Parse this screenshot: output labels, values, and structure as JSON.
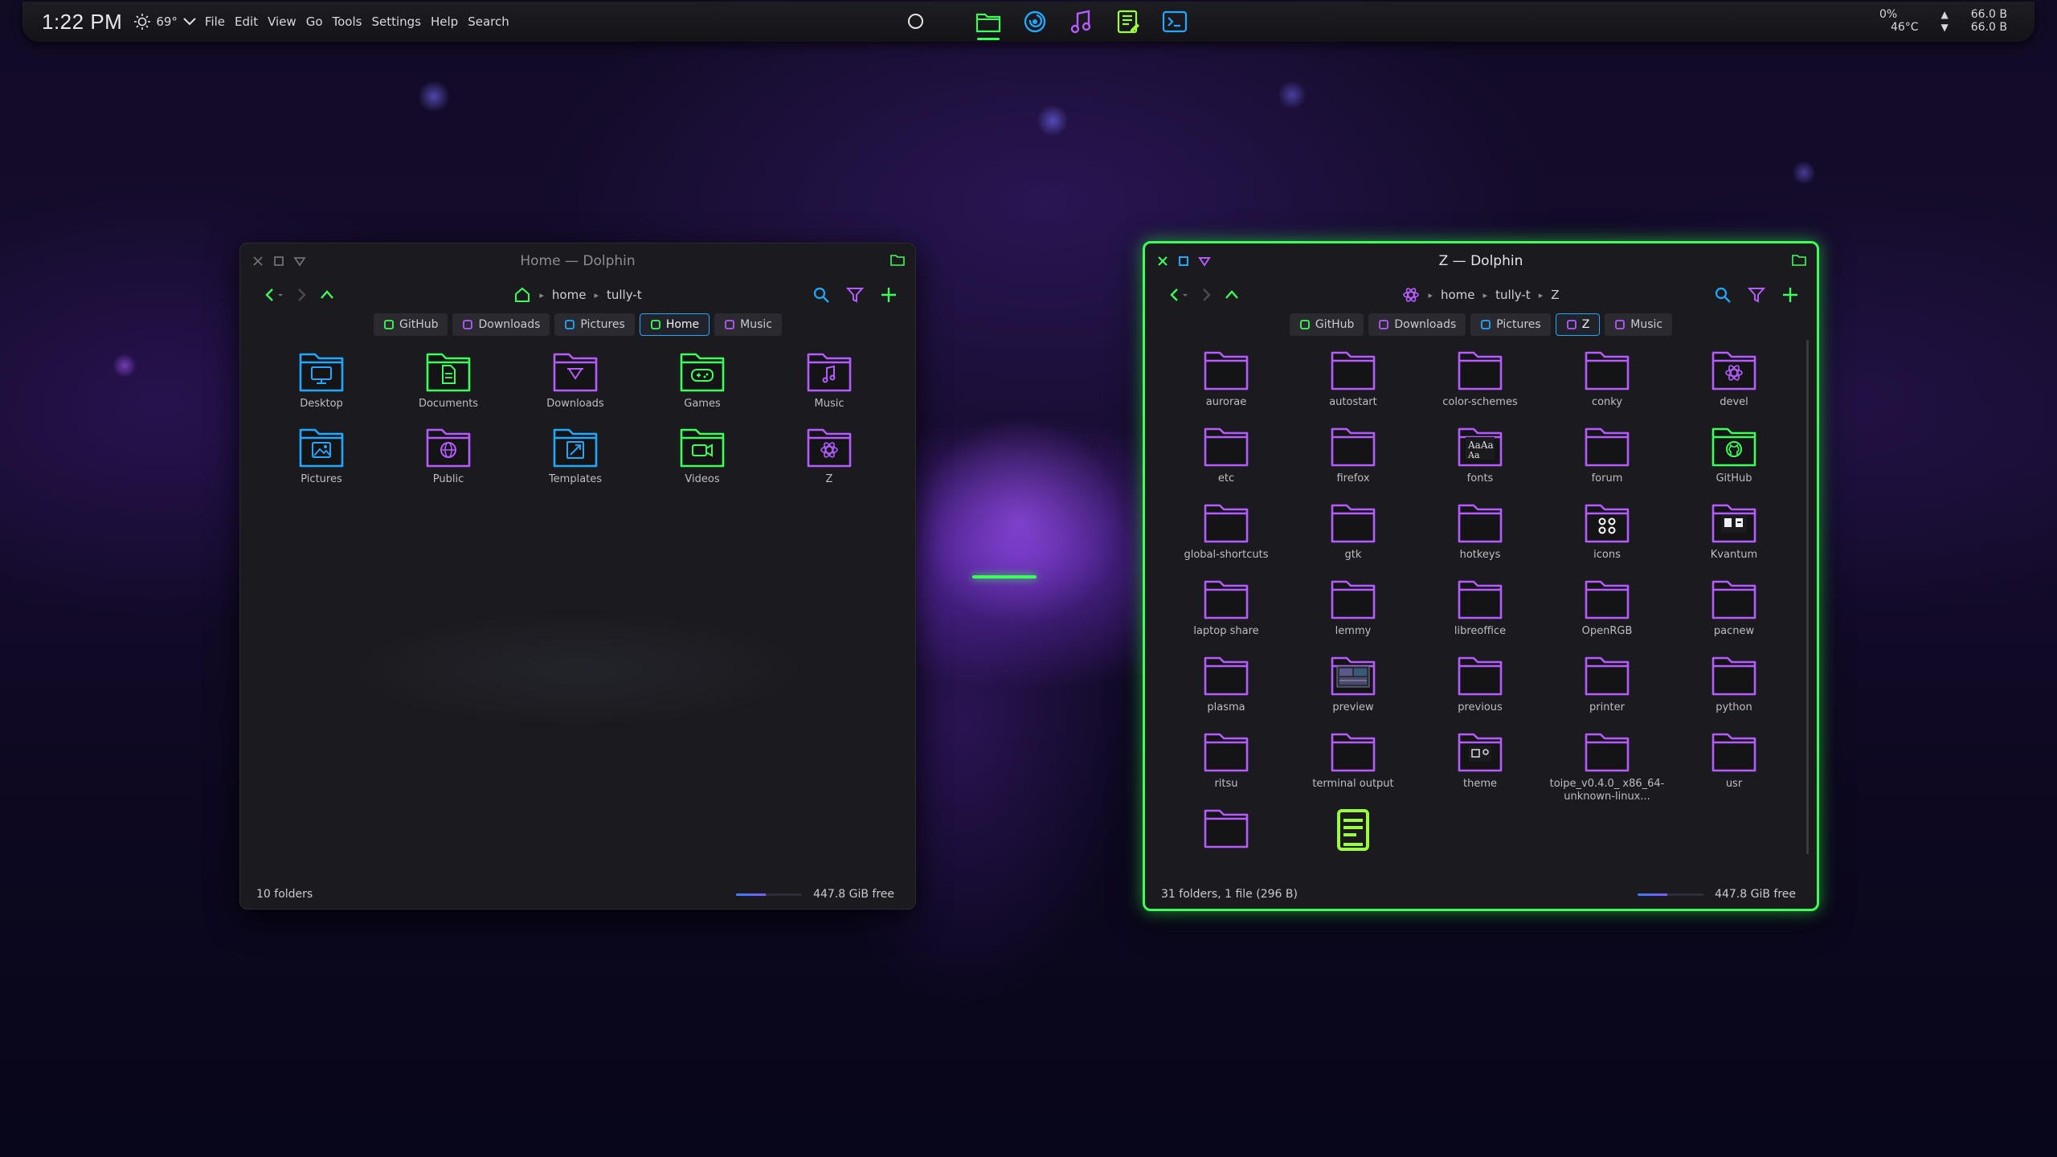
{
  "panel": {
    "clock": "1:22 PM",
    "temperature": "69°",
    "menu": [
      "File",
      "Edit",
      "View",
      "Go",
      "Tools",
      "Settings",
      "Help",
      "Search"
    ],
    "sys_cpu": "0%",
    "sys_temp": "46°C",
    "net_up": "66.0 B",
    "net_down": "66.0 B",
    "taskbar": [
      {
        "name": "dolphin-task",
        "icon": "folder-icon",
        "color": "#3cff5a",
        "active": true
      },
      {
        "name": "browser-task",
        "icon": "browser-swirl-icon",
        "color": "#22a8ff",
        "active": false
      },
      {
        "name": "music-task",
        "icon": "music-note-icon",
        "color": "#b45cff",
        "active": false
      },
      {
        "name": "editor-task",
        "icon": "text-editor-icon",
        "color": "#9bff3c",
        "active": false
      },
      {
        "name": "terminal-task",
        "icon": "terminal-icon",
        "color": "#22a8ff",
        "active": false
      }
    ]
  },
  "home_window": {
    "title": "Home — Dolphin",
    "breadcrumb": [
      "home",
      "tully-t"
    ],
    "places": [
      {
        "label": "GitHub",
        "color": "#3cff5a",
        "active": false
      },
      {
        "label": "Downloads",
        "color": "#b45cff",
        "active": false
      },
      {
        "label": "Pictures",
        "color": "#22a8ff",
        "active": false
      },
      {
        "label": "Home",
        "color": "#3cff5a",
        "active": true
      },
      {
        "label": "Music",
        "color": "#b45cff",
        "active": false
      }
    ],
    "items": [
      {
        "label": "Desktop",
        "icon": "desktop-folder-icon",
        "color": "#22a8ff",
        "emblem": "monitor"
      },
      {
        "label": "Documents",
        "icon": "documents-folder-icon",
        "color": "#3cff5a",
        "emblem": "doc"
      },
      {
        "label": "Downloads",
        "icon": "downloads-folder-icon",
        "color": "#b45cff",
        "emblem": "download"
      },
      {
        "label": "Games",
        "icon": "games-folder-icon",
        "color": "#3cff5a",
        "emblem": "gamepad"
      },
      {
        "label": "Music",
        "icon": "music-folder-icon",
        "color": "#b45cff",
        "emblem": "note"
      },
      {
        "label": "Pictures",
        "icon": "pictures-folder-icon",
        "color": "#22a8ff",
        "emblem": "image"
      },
      {
        "label": "Public",
        "icon": "public-folder-icon",
        "color": "#b45cff",
        "emblem": "globe"
      },
      {
        "label": "Templates",
        "icon": "templates-folder-icon",
        "color": "#22a8ff",
        "emblem": "template"
      },
      {
        "label": "Videos",
        "icon": "videos-folder-icon",
        "color": "#3cff5a",
        "emblem": "video"
      },
      {
        "label": "Z",
        "icon": "z-folder-icon",
        "color": "#b45cff",
        "emblem": "atom"
      }
    ],
    "status": "10 folders",
    "free_space": "447.8 GiB free",
    "free_fraction": 0.45
  },
  "z_window": {
    "title": "Z — Dolphin",
    "breadcrumb": [
      "home",
      "tully-t",
      "Z"
    ],
    "places": [
      {
        "label": "GitHub",
        "color": "#3cff5a",
        "active": false
      },
      {
        "label": "Downloads",
        "color": "#b45cff",
        "active": false
      },
      {
        "label": "Pictures",
        "color": "#22a8ff",
        "active": false
      },
      {
        "label": "Z",
        "color": "#b45cff",
        "active": true
      },
      {
        "label": "Music",
        "color": "#b45cff",
        "active": false
      }
    ],
    "items": [
      {
        "label": "aurorae",
        "icon": "folder-icon",
        "color": "#b45cff",
        "emblem": ""
      },
      {
        "label": "autostart",
        "icon": "folder-icon",
        "color": "#b45cff",
        "emblem": ""
      },
      {
        "label": "color-schemes",
        "icon": "folder-icon",
        "color": "#b45cff",
        "emblem": ""
      },
      {
        "label": "conky",
        "icon": "folder-icon",
        "color": "#b45cff",
        "emblem": ""
      },
      {
        "label": "devel",
        "icon": "devel-folder-icon",
        "color": "#b45cff",
        "emblem": "atom"
      },
      {
        "label": "etc",
        "icon": "folder-icon",
        "color": "#b45cff",
        "emblem": ""
      },
      {
        "label": "firefox",
        "icon": "folder-icon",
        "color": "#b45cff",
        "emblem": ""
      },
      {
        "label": "fonts",
        "icon": "fonts-folder-icon",
        "color": "#b45cff",
        "emblem": "fonts"
      },
      {
        "label": "forum",
        "icon": "folder-icon",
        "color": "#b45cff",
        "emblem": ""
      },
      {
        "label": "GitHub",
        "icon": "github-folder-icon",
        "color": "#3cff5a",
        "emblem": "github"
      },
      {
        "label": "global-shortcuts",
        "icon": "folder-icon",
        "color": "#b45cff",
        "emblem": ""
      },
      {
        "label": "gtk",
        "icon": "folder-icon",
        "color": "#b45cff",
        "emblem": ""
      },
      {
        "label": "hotkeys",
        "icon": "folder-icon",
        "color": "#b45cff",
        "emblem": ""
      },
      {
        "label": "icons",
        "icon": "icons-folder-icon",
        "color": "#b45cff",
        "emblem": "icons"
      },
      {
        "label": "Kvantum",
        "icon": "kvantum-folder-icon",
        "color": "#b45cff",
        "emblem": "kvantum"
      },
      {
        "label": "laptop share",
        "icon": "folder-icon",
        "color": "#b45cff",
        "emblem": ""
      },
      {
        "label": "lemmy",
        "icon": "folder-icon",
        "color": "#b45cff",
        "emblem": ""
      },
      {
        "label": "libreoffice",
        "icon": "folder-icon",
        "color": "#b45cff",
        "emblem": ""
      },
      {
        "label": "OpenRGB",
        "icon": "folder-icon",
        "color": "#b45cff",
        "emblem": ""
      },
      {
        "label": "pacnew",
        "icon": "folder-icon",
        "color": "#b45cff",
        "emblem": ""
      },
      {
        "label": "plasma",
        "icon": "folder-icon",
        "color": "#b45cff",
        "emblem": ""
      },
      {
        "label": "preview",
        "icon": "preview-folder-icon",
        "color": "#b45cff",
        "emblem": "preview"
      },
      {
        "label": "previous",
        "icon": "folder-icon",
        "color": "#b45cff",
        "emblem": ""
      },
      {
        "label": "printer",
        "icon": "folder-icon",
        "color": "#b45cff",
        "emblem": ""
      },
      {
        "label": "python",
        "icon": "folder-icon",
        "color": "#b45cff",
        "emblem": ""
      },
      {
        "label": "ritsu",
        "icon": "folder-icon",
        "color": "#b45cff",
        "emblem": ""
      },
      {
        "label": "terminal output",
        "icon": "folder-icon",
        "color": "#b45cff",
        "emblem": ""
      },
      {
        "label": "theme",
        "icon": "theme-folder-icon",
        "color": "#b45cff",
        "emblem": "theme"
      },
      {
        "label": "toipe_v0.4.0_ x86_64- unknown-linux...",
        "icon": "folder-icon",
        "color": "#b45cff",
        "emblem": ""
      },
      {
        "label": "usr",
        "icon": "folder-icon",
        "color": "#b45cff",
        "emblem": ""
      },
      {
        "label": "",
        "icon": "folder-icon",
        "color": "#b45cff",
        "emblem": ""
      },
      {
        "label": "",
        "icon": "text-file-icon",
        "color": "#9bff3c",
        "emblem": "textfile"
      }
    ],
    "status": "31 folders, 1 file (296 B)",
    "free_space": "447.8 GiB free",
    "free_fraction": 0.45
  }
}
